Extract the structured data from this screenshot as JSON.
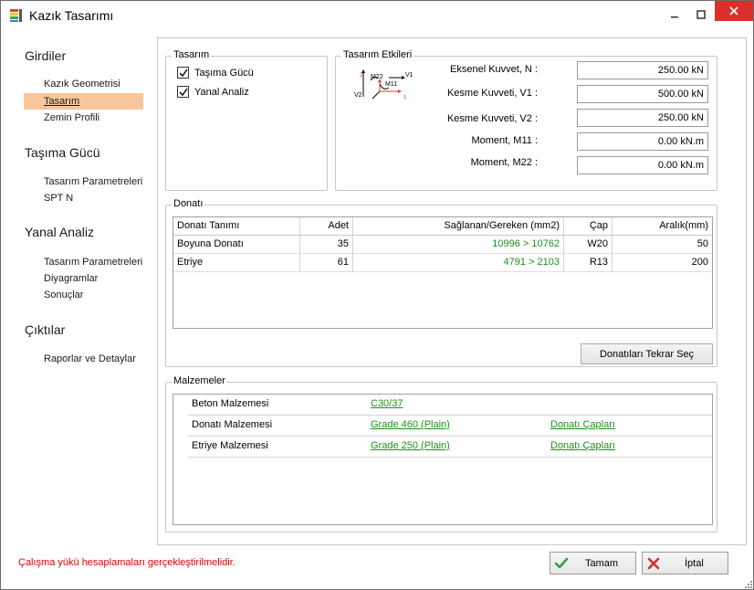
{
  "window": {
    "title": "Kazık Tasarımı"
  },
  "nav": {
    "groups": [
      {
        "label": "Girdiler",
        "items": [
          "Kazık Geometrisi",
          "Tasarım",
          "Zemin Profili"
        ]
      },
      {
        "label": "Taşıma Gücü",
        "items": [
          "Tasarım Parametreleri",
          "SPT N"
        ]
      },
      {
        "label": "Yanal Analiz",
        "items": [
          "Tasarım Parametreleri",
          "Diyagramlar",
          "Sonuçlar"
        ]
      },
      {
        "label": "Çıktılar",
        "items": [
          "Raporlar ve Detaylar"
        ]
      }
    ],
    "active_item": "Tasarım"
  },
  "tasarim": {
    "legend": "Tasarım",
    "options": [
      {
        "label": "Taşıma Gücü",
        "checked": true
      },
      {
        "label": "Yanal Analiz",
        "checked": true
      }
    ]
  },
  "etkiler": {
    "legend": "Tasarım Etkileri",
    "diagram_labels": {
      "v2": "V2",
      "m22": "M22",
      "v1": "V1",
      "m11": "M11",
      "a2": "2",
      "a1": "1"
    },
    "fields": [
      {
        "label": "Eksenel Kuvvet, N :",
        "value": "250.00 kN"
      },
      {
        "label": "Kesme Kuvveti, V1 :",
        "value": "500.00 kN"
      },
      {
        "label": "Kesme Kuvveti, V2 :",
        "value": "250.00 kN"
      },
      {
        "label": "Moment, M11 :",
        "value": "0.00 kN.m"
      },
      {
        "label": "Moment, M22 :",
        "value": "0.00 kN.m"
      }
    ]
  },
  "donati": {
    "legend": "Donatı",
    "columns": [
      "Donatı Tanımı",
      "Adet",
      "Sağlanan/Gereken (mm2)",
      "Çap",
      "Aralık(mm)"
    ],
    "rows": [
      {
        "tanim": "Boyuna Donatı",
        "adet": "35",
        "oran": "10996 > 10762",
        "cap": "W20",
        "aralik": "50"
      },
      {
        "tanim": "Etriye",
        "adet": "61",
        "oran": "4791 > 2103",
        "cap": "R13",
        "aralik": "200"
      }
    ],
    "reselect_button": "Donatıları Tekrar Seç"
  },
  "malzemeler": {
    "legend": "Malzemeler",
    "rows": [
      {
        "label": "Beton Malzemesi",
        "value": "C30/37",
        "extra": ""
      },
      {
        "label": "Donatı Malzemesi",
        "value": "Grade 460 (Plain)",
        "extra": "Donatı Çapları"
      },
      {
        "label": "Etriye Malzemesi",
        "value": "Grade 250 (Plain)",
        "extra": "Donatı Çapları"
      }
    ]
  },
  "footer": {
    "status": "Çalışma yükü hesaplamaları gerçekleştirilmelidir.",
    "ok_label": "Tamam",
    "cancel_label": "İptal"
  },
  "colors": {
    "active_nav": "#f7c69b",
    "link_green": "#1f8f1f",
    "error_red": "#e00000",
    "close_red": "#d9312a"
  },
  "icons": {
    "app": "app-icon",
    "ok": "check-icon",
    "cancel": "cross-icon"
  }
}
